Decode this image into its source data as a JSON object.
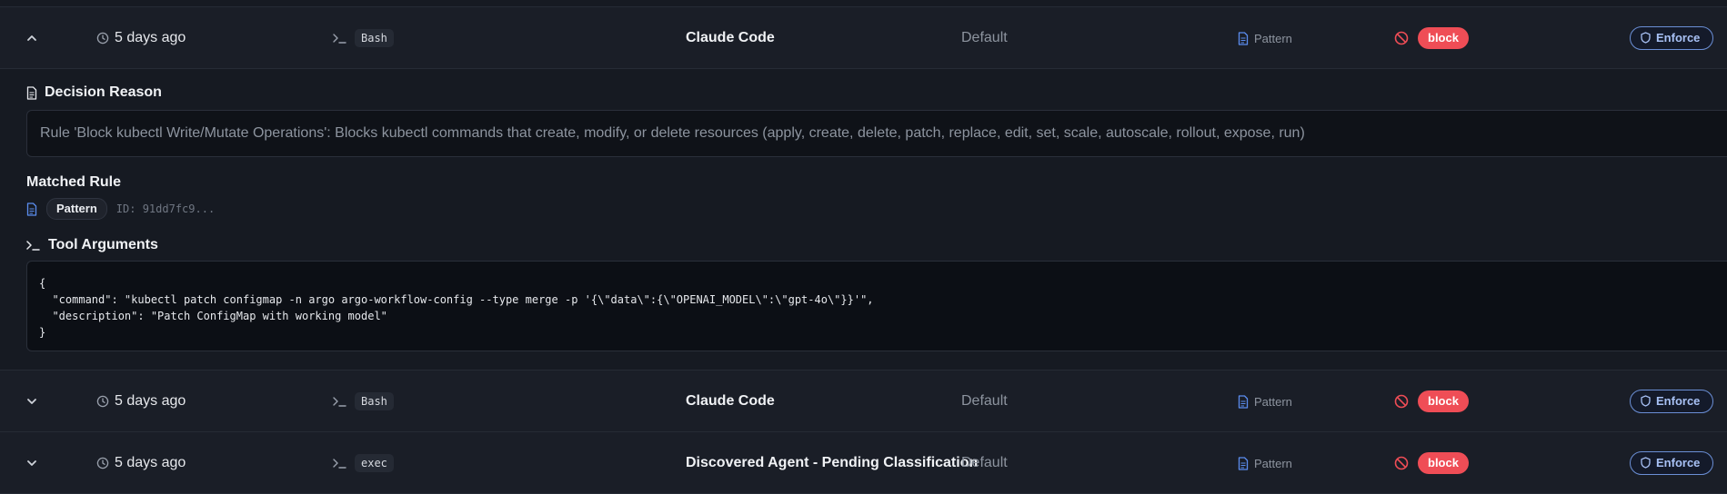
{
  "rows": [
    {
      "expanded": true,
      "time": "5 days ago",
      "tool": "Bash",
      "agent": "Claude Code",
      "policy": "Default",
      "type": "Pattern",
      "verdict": "block",
      "action": "Enforce"
    },
    {
      "expanded": false,
      "time": "5 days ago",
      "tool": "Bash",
      "agent": "Claude Code",
      "policy": "Default",
      "type": "Pattern",
      "verdict": "block",
      "action": "Enforce"
    },
    {
      "expanded": false,
      "time": "5 days ago",
      "tool": "exec",
      "agent": "Discovered Agent - Pending Classification",
      "policy": "Default",
      "type": "Pattern",
      "verdict": "block",
      "action": "Enforce"
    }
  ],
  "detail": {
    "decision_reason_title": "Decision Reason",
    "decision_reason_text": "Rule 'Block kubectl Write/Mutate Operations': Blocks kubectl commands that create, modify, or delete resources (apply, create, delete, patch, replace, edit, set, scale, autoscale, rollout, expose, run)",
    "matched_rule_title": "Matched Rule",
    "matched_rule_type": "Pattern",
    "matched_rule_id": "ID: 91dd7fc9...",
    "tool_arguments_title": "Tool Arguments",
    "tool_arguments_code": "{\n  \"command\": \"kubectl patch configmap -n argo argo-workflow-config --type merge -p '{\\\"data\\\":{\\\"OPENAI_MODEL\\\":\\\"gpt-4o\\\"}}'\",\n  \"description\": \"Patch ConfigMap with working model\"\n}"
  },
  "icons": {
    "chevron_up": "chevron-up-icon",
    "chevron_down": "chevron-down-icon",
    "clock": "clock-icon",
    "terminal": "terminal-icon",
    "document": "document-icon",
    "ban": "ban-icon",
    "shield": "shield-icon"
  },
  "colors": {
    "block_badge": "#ef4d56",
    "ban_icon": "#ef4d56",
    "enforce_border": "#6b8fd6",
    "pattern_icon": "#5b8def"
  }
}
